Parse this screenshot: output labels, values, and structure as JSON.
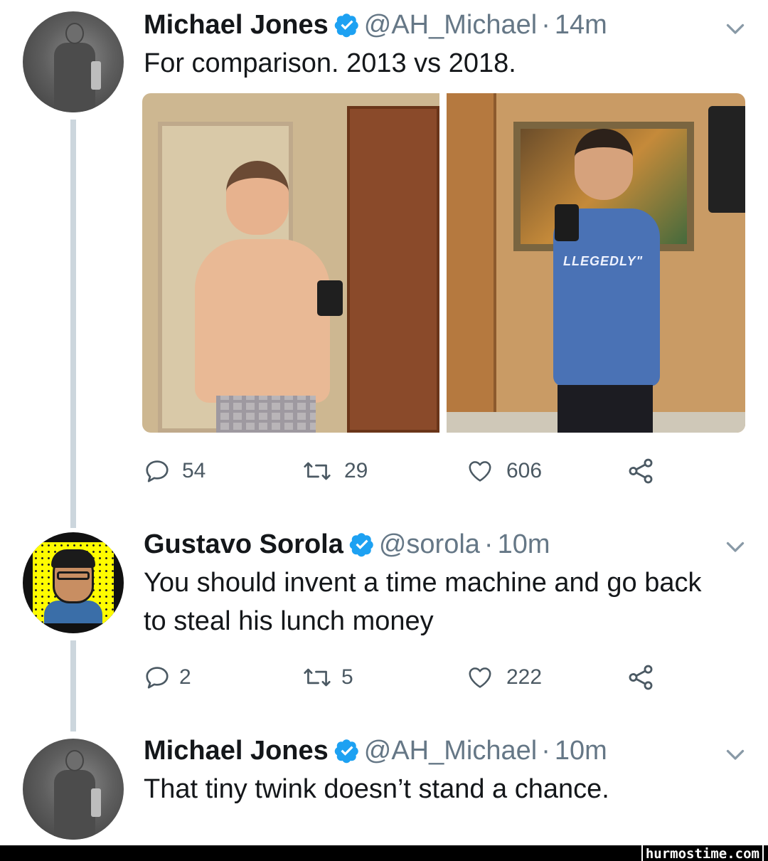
{
  "tweets": [
    {
      "name": "Michael Jones",
      "handle": "@AH_Michael",
      "separator": "·",
      "time": "14m",
      "text": "For comparison. 2013 vs 2018.",
      "media": {
        "right_shirt_text": "LLEGEDLY\""
      },
      "replies": "54",
      "retweets": "29",
      "likes": "606"
    },
    {
      "name": "Gustavo Sorola",
      "handle": "@sorola",
      "separator": "·",
      "time": "10m",
      "text": "You should invent a time machine and go back to steal his lunch money",
      "replies": "2",
      "retweets": "5",
      "likes": "222"
    },
    {
      "name": "Michael Jones",
      "handle": "@AH_Michael",
      "separator": "·",
      "time": "10m",
      "text": "That tiny twink doesn’t stand a chance."
    }
  ],
  "watermark": "hurmostime.com",
  "colors": {
    "verified": "#1da1f2",
    "muted": "#657786",
    "thread_line": "#ccd6dd",
    "icon": "#4b5963"
  },
  "icons": [
    "reply-icon",
    "retweet-icon",
    "like-icon",
    "share-icon",
    "verified-icon",
    "chevron-down-icon"
  ]
}
